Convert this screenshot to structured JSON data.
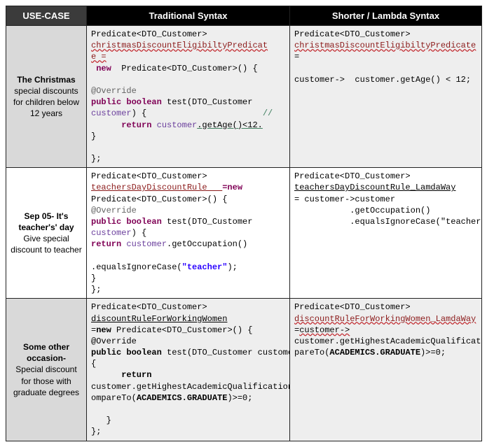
{
  "headers": {
    "usecase": "USE-CASE",
    "traditional": "Traditional Syntax",
    "lambda": "Shorter / Lambda Syntax"
  },
  "rows": [
    {
      "id": "christmas",
      "usecase_title": "The Christmas",
      "usecase_body": "special discounts for children below 12 years",
      "trad": {
        "l1": "Predicate<DTO_Customer>",
        "l2": "christmasDiscountEligibiltyPredicat",
        "l3": "e =",
        "l4_new": " new ",
        "l4_rest": " Predicate<DTO_Customer>() {",
        "l5": "",
        "l6_anno": "@Override",
        "l7_kw": "public boolean",
        "l7_rest": " test(DTO_Customer",
        "l8_cust": "customer",
        "l8_rest": ") {",
        "l8b_cmt": "                       //",
        "l9_ret": "      return ",
        "l9_cust": "customer",
        "l9_rest": ".getAge()<12.",
        "l10": "}",
        "l11": "",
        "l12": "};"
      },
      "lambda": {
        "l1": "Predicate<DTO_Customer>",
        "l2": "christmasDiscountEligibiltyPredicate",
        "l3": "=",
        "l4": "",
        "l5": "customer->  customer.getAge() < 12;"
      }
    },
    {
      "id": "teachers",
      "usecase_title": "Sep 05- It's teacher's' day",
      "usecase_body": "Give special discount to teacher",
      "trad": {
        "l1": "Predicate<DTO_Customer>",
        "l2_name": "teachersDayDiscountRule   ",
        "l2_new": "=new",
        "l3": "Predicate<DTO_Customer>() {",
        "l4_anno": "@Override",
        "l5_kw": "public boolean",
        "l5_rest": " test(DTO_Customer",
        "l6_cust": "customer",
        "l6_rest": ") {",
        "l7_ret": "return ",
        "l7_cust": "customer",
        "l7_rest": ".getOccupation()",
        "l8": "",
        "l9_a": ".equalsIgnoreCase(",
        "l9_str": "\"teacher\"",
        "l9_b": ");",
        "l10": "}",
        "l11": "};"
      },
      "lambda": {
        "l1": "Predicate<DTO_Customer>",
        "l2": "teachersDayDiscountRule_LamdaWay",
        "l3": "= customer->customer",
        "l4": "           .getOccupation()",
        "l5": "           .equalsIgnoreCase(\"teacher\");"
      }
    },
    {
      "id": "other",
      "usecase_title": "Some other occasion-",
      "usecase_body": "Special discount for those with graduate degrees",
      "trad": {
        "l1": "Predicate<DTO_Customer>",
        "l2": "discountRuleForWorkingWomen",
        "l3_a": "=",
        "l3_new": "new",
        "l3_b": " Predicate<DTO_Customer>() {",
        "l4": "@Override",
        "l5_kw": "public boolean",
        "l5_rest": " test(DTO_Customer customer)",
        "l6": "{",
        "l7_ret": "      return",
        "l8": "customer.getHighestAcademicQualification().c",
        "l9_a": "ompareTo(",
        "l9_b": "ACADEMICS.GRADUATE",
        "l9_c": ")>=0;",
        "l10": "",
        "l11": "   }",
        "l12": "};"
      },
      "lambda": {
        "l1": "Predicate<DTO_Customer>",
        "l2": "discountRuleForWorkingWomen_LamdaWay",
        "l3_a": "=",
        "l3_b": "customer->",
        "l4": "customer.getHighestAcademicQualification().com",
        "l5_a": "pareTo(",
        "l5_b": "ACADEMICS.GRADUATE",
        "l5_c": ")>=0;"
      }
    }
  ]
}
